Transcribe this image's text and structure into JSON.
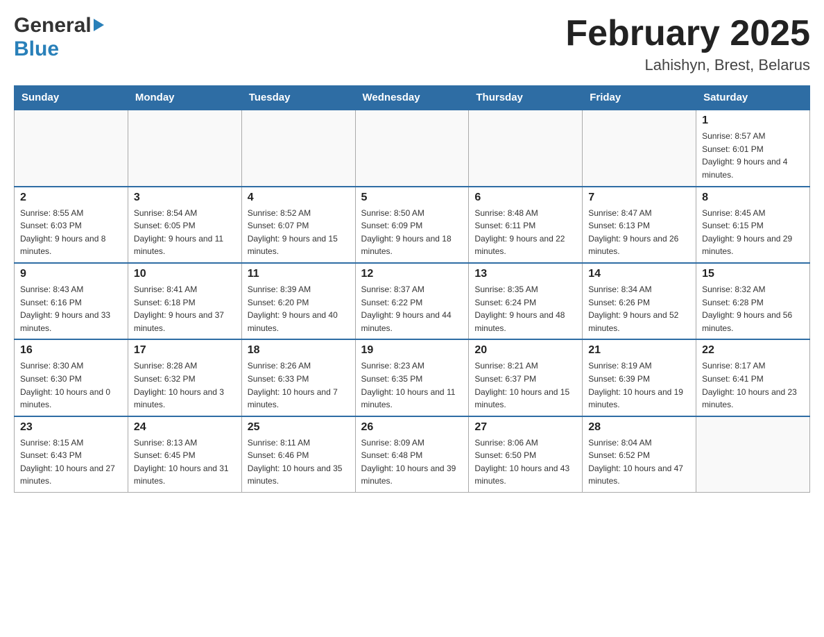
{
  "header": {
    "logo_general": "General",
    "logo_blue": "Blue",
    "month_title": "February 2025",
    "location": "Lahishyn, Brest, Belarus"
  },
  "days_of_week": [
    "Sunday",
    "Monday",
    "Tuesday",
    "Wednesday",
    "Thursday",
    "Friday",
    "Saturday"
  ],
  "weeks": [
    [
      {
        "day": "",
        "sunrise": "",
        "sunset": "",
        "daylight": ""
      },
      {
        "day": "",
        "sunrise": "",
        "sunset": "",
        "daylight": ""
      },
      {
        "day": "",
        "sunrise": "",
        "sunset": "",
        "daylight": ""
      },
      {
        "day": "",
        "sunrise": "",
        "sunset": "",
        "daylight": ""
      },
      {
        "day": "",
        "sunrise": "",
        "sunset": "",
        "daylight": ""
      },
      {
        "day": "",
        "sunrise": "",
        "sunset": "",
        "daylight": ""
      },
      {
        "day": "1",
        "sunrise": "Sunrise: 8:57 AM",
        "sunset": "Sunset: 6:01 PM",
        "daylight": "Daylight: 9 hours and 4 minutes."
      }
    ],
    [
      {
        "day": "2",
        "sunrise": "Sunrise: 8:55 AM",
        "sunset": "Sunset: 6:03 PM",
        "daylight": "Daylight: 9 hours and 8 minutes."
      },
      {
        "day": "3",
        "sunrise": "Sunrise: 8:54 AM",
        "sunset": "Sunset: 6:05 PM",
        "daylight": "Daylight: 9 hours and 11 minutes."
      },
      {
        "day": "4",
        "sunrise": "Sunrise: 8:52 AM",
        "sunset": "Sunset: 6:07 PM",
        "daylight": "Daylight: 9 hours and 15 minutes."
      },
      {
        "day": "5",
        "sunrise": "Sunrise: 8:50 AM",
        "sunset": "Sunset: 6:09 PM",
        "daylight": "Daylight: 9 hours and 18 minutes."
      },
      {
        "day": "6",
        "sunrise": "Sunrise: 8:48 AM",
        "sunset": "Sunset: 6:11 PM",
        "daylight": "Daylight: 9 hours and 22 minutes."
      },
      {
        "day": "7",
        "sunrise": "Sunrise: 8:47 AM",
        "sunset": "Sunset: 6:13 PM",
        "daylight": "Daylight: 9 hours and 26 minutes."
      },
      {
        "day": "8",
        "sunrise": "Sunrise: 8:45 AM",
        "sunset": "Sunset: 6:15 PM",
        "daylight": "Daylight: 9 hours and 29 minutes."
      }
    ],
    [
      {
        "day": "9",
        "sunrise": "Sunrise: 8:43 AM",
        "sunset": "Sunset: 6:16 PM",
        "daylight": "Daylight: 9 hours and 33 minutes."
      },
      {
        "day": "10",
        "sunrise": "Sunrise: 8:41 AM",
        "sunset": "Sunset: 6:18 PM",
        "daylight": "Daylight: 9 hours and 37 minutes."
      },
      {
        "day": "11",
        "sunrise": "Sunrise: 8:39 AM",
        "sunset": "Sunset: 6:20 PM",
        "daylight": "Daylight: 9 hours and 40 minutes."
      },
      {
        "day": "12",
        "sunrise": "Sunrise: 8:37 AM",
        "sunset": "Sunset: 6:22 PM",
        "daylight": "Daylight: 9 hours and 44 minutes."
      },
      {
        "day": "13",
        "sunrise": "Sunrise: 8:35 AM",
        "sunset": "Sunset: 6:24 PM",
        "daylight": "Daylight: 9 hours and 48 minutes."
      },
      {
        "day": "14",
        "sunrise": "Sunrise: 8:34 AM",
        "sunset": "Sunset: 6:26 PM",
        "daylight": "Daylight: 9 hours and 52 minutes."
      },
      {
        "day": "15",
        "sunrise": "Sunrise: 8:32 AM",
        "sunset": "Sunset: 6:28 PM",
        "daylight": "Daylight: 9 hours and 56 minutes."
      }
    ],
    [
      {
        "day": "16",
        "sunrise": "Sunrise: 8:30 AM",
        "sunset": "Sunset: 6:30 PM",
        "daylight": "Daylight: 10 hours and 0 minutes."
      },
      {
        "day": "17",
        "sunrise": "Sunrise: 8:28 AM",
        "sunset": "Sunset: 6:32 PM",
        "daylight": "Daylight: 10 hours and 3 minutes."
      },
      {
        "day": "18",
        "sunrise": "Sunrise: 8:26 AM",
        "sunset": "Sunset: 6:33 PM",
        "daylight": "Daylight: 10 hours and 7 minutes."
      },
      {
        "day": "19",
        "sunrise": "Sunrise: 8:23 AM",
        "sunset": "Sunset: 6:35 PM",
        "daylight": "Daylight: 10 hours and 11 minutes."
      },
      {
        "day": "20",
        "sunrise": "Sunrise: 8:21 AM",
        "sunset": "Sunset: 6:37 PM",
        "daylight": "Daylight: 10 hours and 15 minutes."
      },
      {
        "day": "21",
        "sunrise": "Sunrise: 8:19 AM",
        "sunset": "Sunset: 6:39 PM",
        "daylight": "Daylight: 10 hours and 19 minutes."
      },
      {
        "day": "22",
        "sunrise": "Sunrise: 8:17 AM",
        "sunset": "Sunset: 6:41 PM",
        "daylight": "Daylight: 10 hours and 23 minutes."
      }
    ],
    [
      {
        "day": "23",
        "sunrise": "Sunrise: 8:15 AM",
        "sunset": "Sunset: 6:43 PM",
        "daylight": "Daylight: 10 hours and 27 minutes."
      },
      {
        "day": "24",
        "sunrise": "Sunrise: 8:13 AM",
        "sunset": "Sunset: 6:45 PM",
        "daylight": "Daylight: 10 hours and 31 minutes."
      },
      {
        "day": "25",
        "sunrise": "Sunrise: 8:11 AM",
        "sunset": "Sunset: 6:46 PM",
        "daylight": "Daylight: 10 hours and 35 minutes."
      },
      {
        "day": "26",
        "sunrise": "Sunrise: 8:09 AM",
        "sunset": "Sunset: 6:48 PM",
        "daylight": "Daylight: 10 hours and 39 minutes."
      },
      {
        "day": "27",
        "sunrise": "Sunrise: 8:06 AM",
        "sunset": "Sunset: 6:50 PM",
        "daylight": "Daylight: 10 hours and 43 minutes."
      },
      {
        "day": "28",
        "sunrise": "Sunrise: 8:04 AM",
        "sunset": "Sunset: 6:52 PM",
        "daylight": "Daylight: 10 hours and 47 minutes."
      },
      {
        "day": "",
        "sunrise": "",
        "sunset": "",
        "daylight": ""
      }
    ]
  ]
}
